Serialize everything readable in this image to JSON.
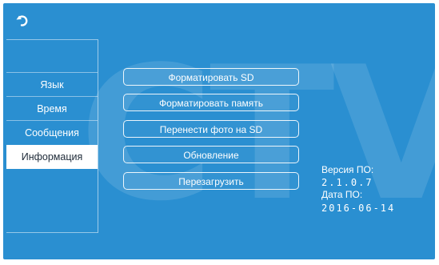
{
  "sidebar": {
    "items": [
      {
        "label": "Язык"
      },
      {
        "label": "Время"
      },
      {
        "label": "Сообщения"
      },
      {
        "label": "Информация",
        "active": true
      }
    ]
  },
  "actions": [
    {
      "label": "Форматировать SD"
    },
    {
      "label": "Форматировать память"
    },
    {
      "label": "Перенести фото на SD"
    },
    {
      "label": "Обновление"
    },
    {
      "label": "Перезагрузить"
    }
  ],
  "info": {
    "version_label": "Версия ПО:",
    "version_value": "2.1.0.7",
    "date_label": "Дата ПО:",
    "date_value": "2016-06-14"
  },
  "watermark": "CTV",
  "colors": {
    "background": "#2a8fd1",
    "active_item_bg": "#ffffff",
    "text": "#ffffff"
  },
  "icons": {
    "back": "back-arrow-icon"
  }
}
